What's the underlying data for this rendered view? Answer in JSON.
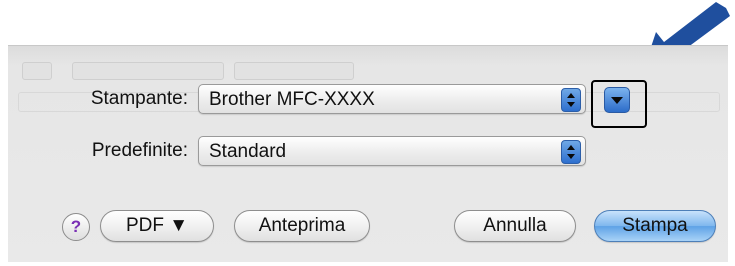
{
  "dialog": {
    "printer_label": "Stampante:",
    "printer_value": "Brother MFC-XXXX",
    "presets_label": "Predefinite:",
    "presets_value": "Standard"
  },
  "buttons": {
    "help": "?",
    "pdf": "PDF ▼",
    "preview": "Anteprima",
    "cancel": "Annulla",
    "print": "Stampa"
  },
  "colors": {
    "arrow": "#1f4f9e",
    "accent": "#5ea2e6"
  }
}
